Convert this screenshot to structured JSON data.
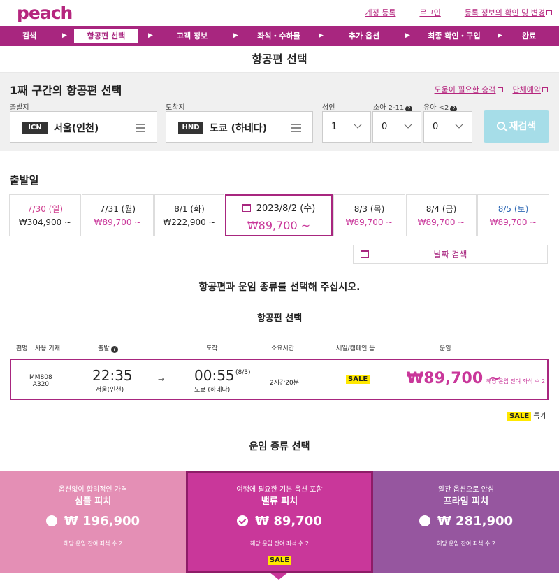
{
  "header": {
    "logo": "peach",
    "links": [
      "계정 등록",
      "로그인",
      "등록 정보의 확인 및 변경"
    ]
  },
  "steps": [
    "검색",
    "항공편 선택",
    "고객 정보",
    "좌석・수하물",
    "추가 옵션",
    "최종 확인・구입",
    "완료"
  ],
  "active_step": "항공편 선택",
  "page_title": "항공편 선택",
  "search": {
    "segment_title": "1째 구간의 항공편 선택",
    "help_links": [
      "도움이 필요한 승객",
      "단체예약"
    ],
    "origin_label": "출발지",
    "origin_code": "ICN",
    "origin_name": "서울(인천)",
    "dest_label": "도착지",
    "dest_code": "HND",
    "dest_name": "도쿄 (하네다)",
    "adult_label": "성인",
    "adult_value": "1",
    "child_label": "소아 2-11",
    "child_value": "0",
    "infant_label": "유아 <2",
    "infant_value": "0",
    "research_label": "재검색"
  },
  "departure": {
    "label": "출발일",
    "dates": [
      {
        "date": "7/30 (일)",
        "price": "₩304,900 ~"
      },
      {
        "date": "7/31 (월)",
        "price": "₩89,700 ~"
      },
      {
        "date": "8/1 (화)",
        "price": "₩222,900 ~"
      },
      {
        "date": "2023/8/2 (수)",
        "price": "₩89,700 ~"
      },
      {
        "date": "8/3 (목)",
        "price": "₩89,700 ~"
      },
      {
        "date": "8/4 (금)",
        "price": "₩89,700 ~"
      },
      {
        "date": "8/5 (토)",
        "price": "₩89,700 ~"
      }
    ],
    "date_search_label": "날짜 검색"
  },
  "instruction": "항공편과 운임 종류를 선택해 주십시오.",
  "flight_select_title": "항공편 선택",
  "table": {
    "headers": [
      "편명",
      "사용 기재",
      "출발",
      "도착",
      "소요시간",
      "세일/캠페인 등",
      "운임"
    ],
    "row": {
      "flight": "MM808",
      "aircraft": "A320",
      "dep_time": "22:35",
      "dep_place": "서울(인천)",
      "arrow": "→",
      "arr_time": "00:55",
      "arr_day": "(8/3)",
      "arr_place": "도쿄 (하네다)",
      "duration": "2시간20분",
      "sale": "SALE",
      "fare": "₩89,700 ~",
      "seats_note": "해당 운임 잔여 좌석 수 2"
    }
  },
  "legend": {
    "badge": "SALE",
    "text": "특가"
  },
  "fare_type_title": "운임 종류 선택",
  "fare_cards": [
    {
      "subtitle": "옵션없이 합리적인 가격",
      "name": "심플 피치",
      "price": "₩ 196,900",
      "seats": "해당 운임 잔여 좌석 수 2",
      "color": "#e48fb5"
    },
    {
      "subtitle": "여행에 필요한 기본 옵션 포함",
      "name": "밸류 피치",
      "price": "₩ 89,700",
      "seats": "해당 운임 잔여 좌석 수 2",
      "sale": "SALE",
      "color": "#c9379a"
    },
    {
      "subtitle": "알찬 옵션으로 안심",
      "name": "프라임 피치",
      "price": "₩ 281,900",
      "seats": "해당 운임 잔여 좌석 수 2",
      "color": "#96569f"
    }
  ],
  "colors": {
    "brand": "#a8267f",
    "accent_pink": "#c9379a",
    "research_button": "#a6dde8",
    "sale_badge": "#ffe800"
  }
}
